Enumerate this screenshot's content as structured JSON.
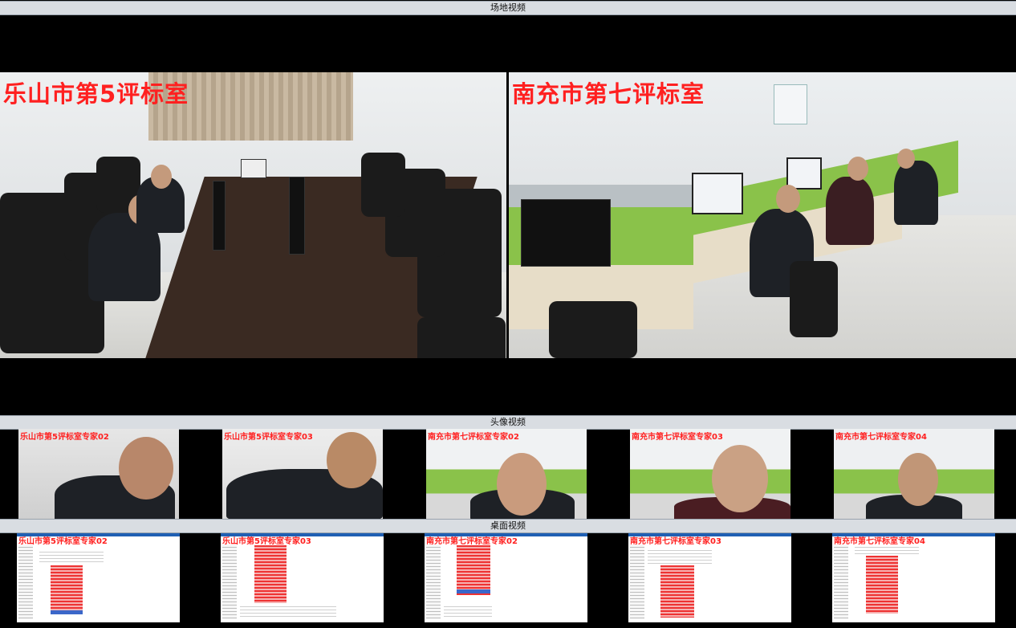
{
  "sections": {
    "site_video": "场地视频",
    "avatar_video": "头像视频",
    "desktop_video": "桌面视频"
  },
  "site": {
    "left_room": "乐山市第5评标室",
    "right_room": "南充市第七评标室"
  },
  "avatars": [
    "乐山市第5评标室专家02",
    "乐山市第5评标室专家03",
    "南充市第七评标室专家02",
    "南充市第七评标室专家03",
    "南充市第七评标室专家04"
  ],
  "desktops": [
    "乐山市第5评标室专家02",
    "乐山市第5评标室专家03",
    "南充市第七评标室专家02",
    "南充市第七评标室专家03",
    "南充市第七评标室专家04"
  ],
  "colors": {
    "label_red": "#ff2020",
    "bar_bg": "#d9dde2",
    "accent_blue": "#1f5fb3"
  }
}
